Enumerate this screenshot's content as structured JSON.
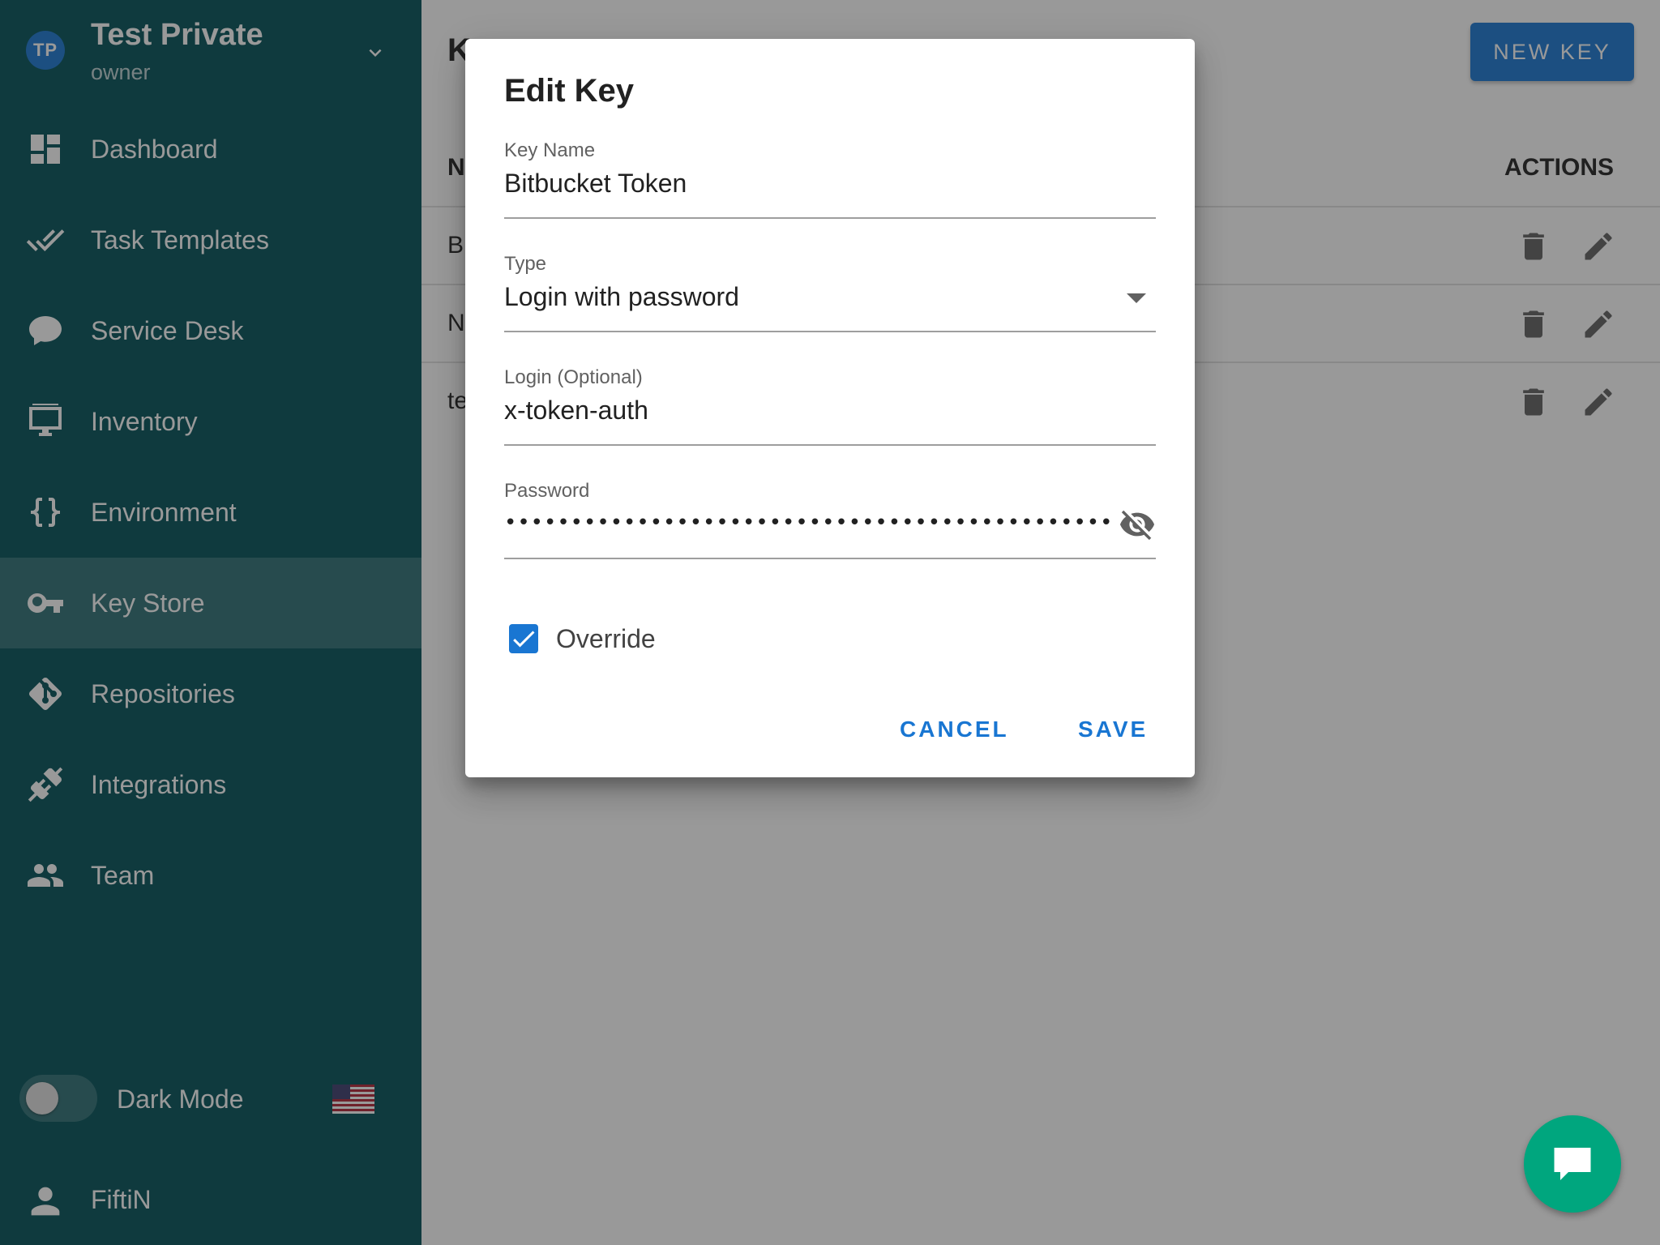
{
  "project": {
    "initials": "TP",
    "name": "Test Private",
    "role": "owner"
  },
  "sidebar": {
    "items": [
      {
        "label": "Dashboard",
        "icon": "dashboard-icon"
      },
      {
        "label": "Task Templates",
        "icon": "double-check-icon"
      },
      {
        "label": "Service Desk",
        "icon": "chat-bubble-icon"
      },
      {
        "label": "Inventory",
        "icon": "monitor-icon"
      },
      {
        "label": "Environment",
        "icon": "braces-icon"
      },
      {
        "label": "Key Store",
        "icon": "key-icon",
        "active": true
      },
      {
        "label": "Repositories",
        "icon": "git-icon"
      },
      {
        "label": "Integrations",
        "icon": "plug-icon"
      },
      {
        "label": "Team",
        "icon": "team-icon"
      }
    ],
    "dark_mode_label": "Dark Mode",
    "dark_mode_on": false,
    "user_name": "FiftiN"
  },
  "main": {
    "title_initial": "K",
    "new_key_label": "NEW KEY",
    "col_name_initial": "N",
    "col_actions": "ACTIONS",
    "rows": [
      {
        "name_initial": "B"
      },
      {
        "name_initial": "N"
      },
      {
        "name_initial": "te"
      }
    ]
  },
  "dialog": {
    "title": "Edit Key",
    "key_name_label": "Key Name",
    "key_name_value": "Bitbucket Token",
    "type_label": "Type",
    "type_value": "Login with password",
    "login_label": "Login (Optional)",
    "login_value": "x-token-auth",
    "password_label": "Password",
    "password_mask": "••••••••••••••••••••••••••••••••••••••••••••••••••••••••••••••••••••••••••••••••••••••••",
    "override_label": "Override",
    "override_checked": true,
    "cancel_label": "CANCEL",
    "save_label": "SAVE"
  },
  "colors": {
    "sidebar_bg": "#005057",
    "accent": "#1976d2",
    "chat_fab": "#00a67e"
  }
}
